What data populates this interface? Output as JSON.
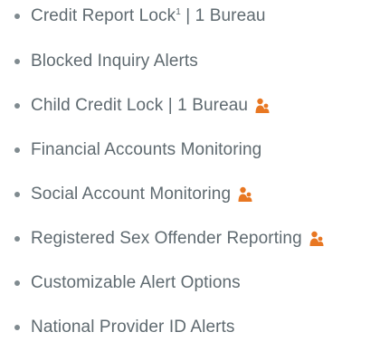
{
  "colors": {
    "text": "#5f6a70",
    "bullet": "#808b90",
    "family_icon": "#e87722"
  },
  "features": [
    {
      "label": "Credit Report Lock",
      "sup": "1",
      "suffix": " | 1 Bureau",
      "family_icon": false
    },
    {
      "label": "Blocked Inquiry Alerts",
      "family_icon": false
    },
    {
      "label": "Child Credit Lock | 1 Bureau",
      "family_icon": true,
      "icon": "family-icon"
    },
    {
      "label": "Financial Accounts Monitoring",
      "family_icon": false
    },
    {
      "label": "Social Account Monitoring",
      "family_icon": true,
      "icon": "family-icon"
    },
    {
      "label": "Registered Sex Offender Reporting",
      "family_icon": true,
      "icon": "family-icon"
    },
    {
      "label": "Customizable Alert Options",
      "family_icon": false
    },
    {
      "label": "National Provider ID Alerts",
      "family_icon": false
    }
  ]
}
